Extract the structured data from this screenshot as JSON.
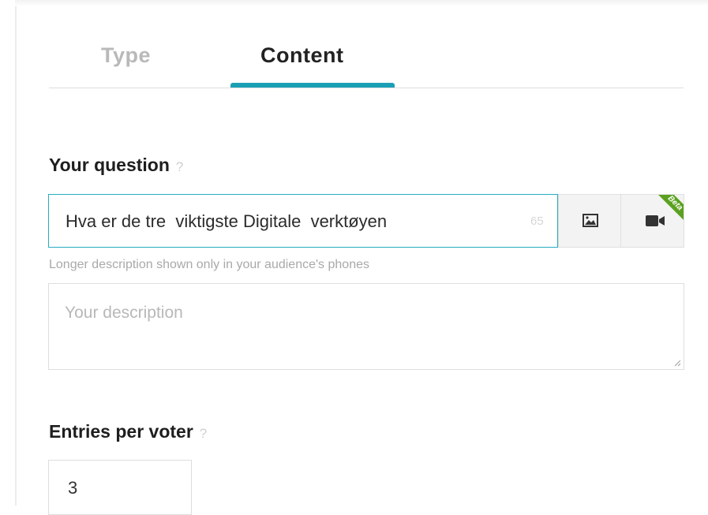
{
  "tabs": {
    "type_label": "Type",
    "content_label": "Content",
    "active": "Content"
  },
  "question": {
    "label": "Your question",
    "help": "?",
    "value": "Hva er de tre  viktigste Digitale  verktøyen",
    "char_count": "65",
    "image_button_icon": "image-icon",
    "video_button_icon": "video-camera-icon",
    "beta_badge": "Beta"
  },
  "description": {
    "hint": "Longer description shown only in your audience's phones",
    "placeholder": "Your description"
  },
  "entries": {
    "label": "Entries per voter",
    "help": "?",
    "value": "3"
  },
  "colors": {
    "accent": "#1b9fb5",
    "beta_green": "#5ba11f",
    "inactive_tab": "#b9b9b9"
  }
}
